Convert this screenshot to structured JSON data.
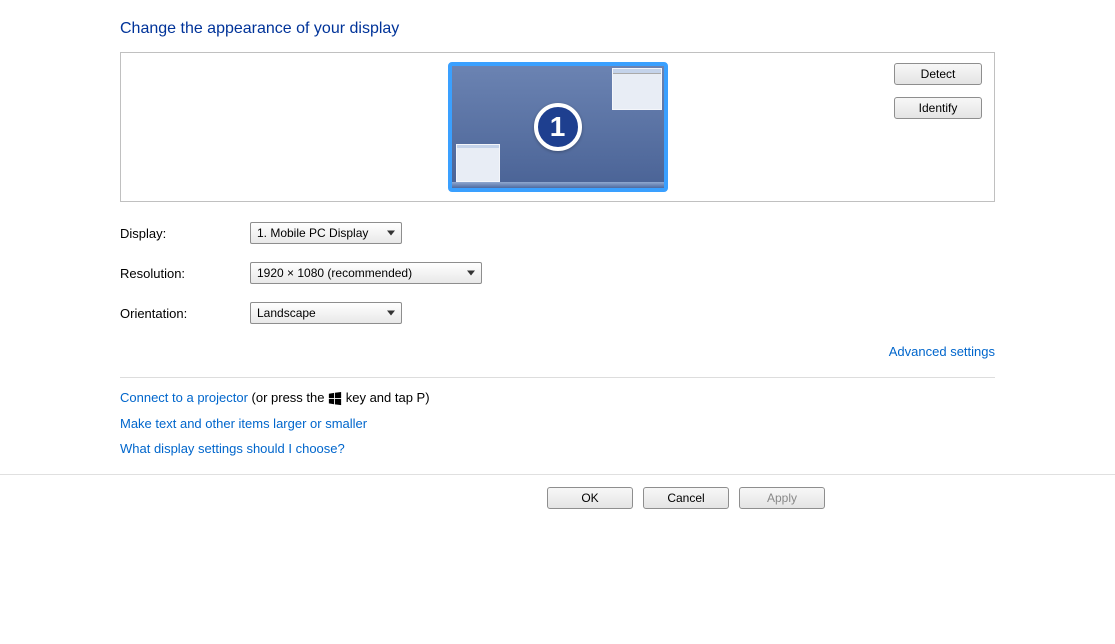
{
  "title": "Change the appearance of your display",
  "preview": {
    "monitor_number": "1",
    "detect_label": "Detect",
    "identify_label": "Identify"
  },
  "form": {
    "display_label": "Display:",
    "display_value": "1. Mobile PC Display",
    "resolution_label": "Resolution:",
    "resolution_value": "1920 × 1080 (recommended)",
    "orientation_label": "Orientation:",
    "orientation_value": "Landscape"
  },
  "links": {
    "advanced": "Advanced settings",
    "projector": "Connect to a projector",
    "projector_hint_pre": " (or press the ",
    "projector_hint_post": " key and tap P)",
    "text_size": "Make text and other items larger or smaller",
    "help": "What display settings should I choose?"
  },
  "buttons": {
    "ok": "OK",
    "cancel": "Cancel",
    "apply": "Apply"
  }
}
